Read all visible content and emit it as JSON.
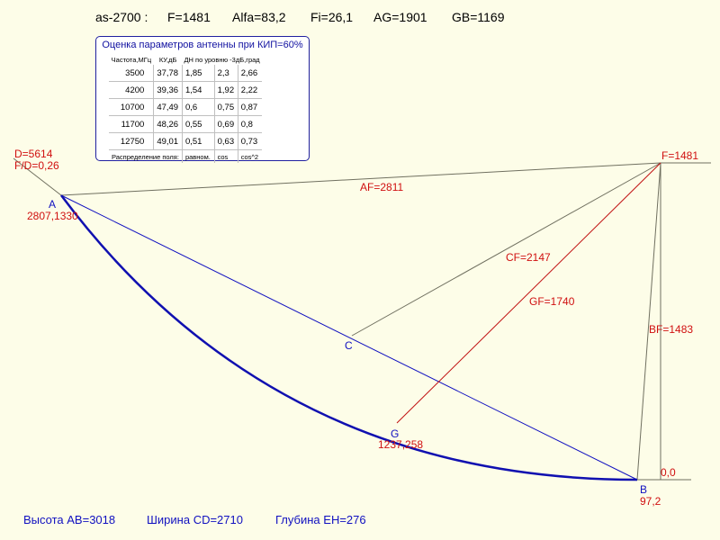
{
  "header": {
    "model": "as-2700 :",
    "focus": "F=1481",
    "alfa": "Alfa=83,2",
    "fi": "Fi=26,1",
    "ag": "AG=1901",
    "gb": "GB=1169"
  },
  "panel": {
    "title": "Оценка параметров антенны при КИП=60%",
    "columns": [
      "Частота,МГц",
      "КУ,дБ",
      "ДН по уровню -3дБ,град"
    ],
    "rows": [
      [
        "3500",
        "37,78",
        "1,85",
        "2,3",
        "2,66"
      ],
      [
        "4200",
        "39,36",
        "1,54",
        "1,92",
        "2,22"
      ],
      [
        "10700",
        "47,49",
        "0,6",
        "0,75",
        "0,87"
      ],
      [
        "11700",
        "48,26",
        "0,55",
        "0,69",
        "0,8"
      ],
      [
        "12750",
        "49,01",
        "0,51",
        "0,63",
        "0,73"
      ]
    ],
    "distribution_label": "Распределение поля:",
    "distributions": [
      "равном.",
      "cos",
      "cos^2"
    ]
  },
  "labels": {
    "diameter": "D=5614",
    "fd": "F/D=0,26",
    "point_a": "A",
    "coord_a": "2807,1330",
    "af": "AF=2811",
    "point_f": "F=1481",
    "cf": "CF=2147",
    "gf": "GF=1740",
    "bf": "BF=1483",
    "point_c": "C",
    "point_g": "G",
    "coord_g": "1237,258",
    "origin": "0,0",
    "point_b": "B",
    "coord_b": "97,2"
  },
  "footer": {
    "height": "Высота AB=3018",
    "width": "Ширина CD=2710",
    "depth": "Глубина EH=276"
  },
  "colors": {
    "background": "#fdfde8",
    "dish": "#1010b0",
    "red_line": "#c01010",
    "thin_line": "#707060",
    "label_red": "#d01010",
    "label_blue": "#1010c0"
  }
}
